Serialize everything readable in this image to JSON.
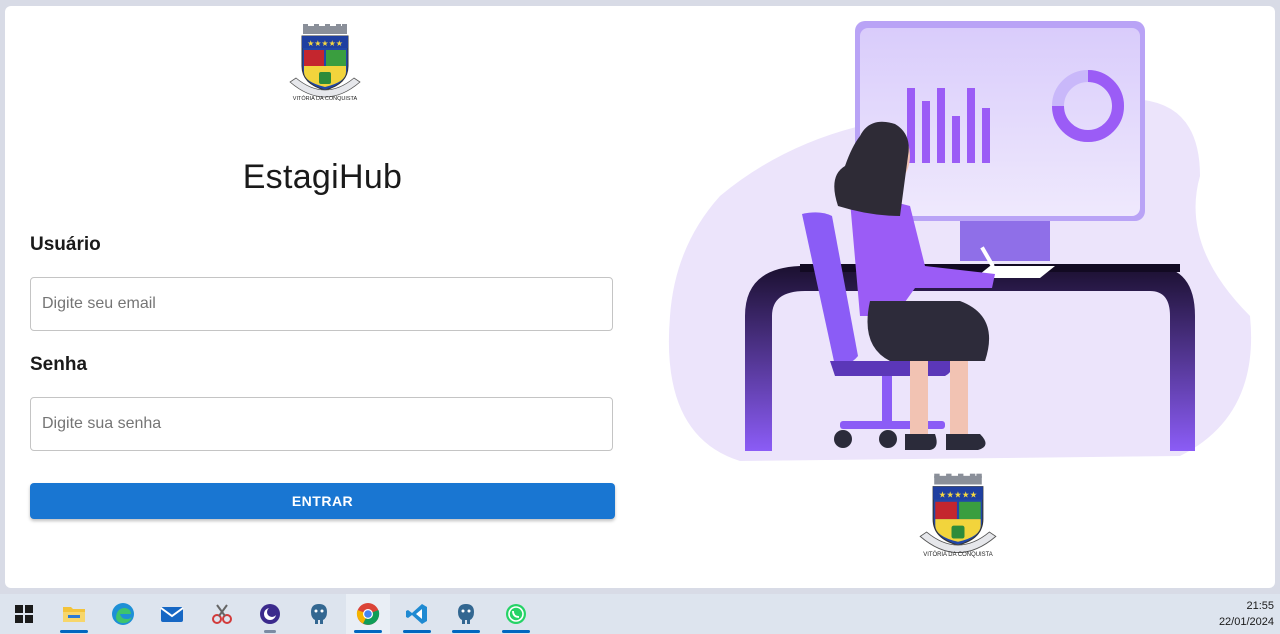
{
  "app": {
    "title": "EstagiHub"
  },
  "crest": {
    "motto": "VITÓRIA DA CONQUISTA"
  },
  "form": {
    "user_label": "Usuário",
    "user_placeholder": "Digite seu email",
    "user_value": "",
    "password_label": "Senha",
    "password_placeholder": "Digite sua senha",
    "password_value": "",
    "submit_label": "ENTRAR"
  },
  "taskbar": {
    "items": [
      {
        "icon": "windows-start-icon"
      },
      {
        "icon": "file-explorer-icon"
      },
      {
        "icon": "edge-browser-icon"
      },
      {
        "icon": "mail-icon"
      },
      {
        "icon": "snipping-tool-icon"
      },
      {
        "icon": "moon-app-icon"
      },
      {
        "icon": "postgresql-icon"
      },
      {
        "icon": "chrome-icon"
      },
      {
        "icon": "vscode-icon"
      },
      {
        "icon": "postgresql-icon"
      },
      {
        "icon": "whatsapp-icon"
      }
    ],
    "time": "21:55",
    "date": "22/01/2024"
  },
  "colors": {
    "primary_button": "#1976d2",
    "accent_purple": "#9b5cf6",
    "illustration_blob": "#ece4fb"
  }
}
